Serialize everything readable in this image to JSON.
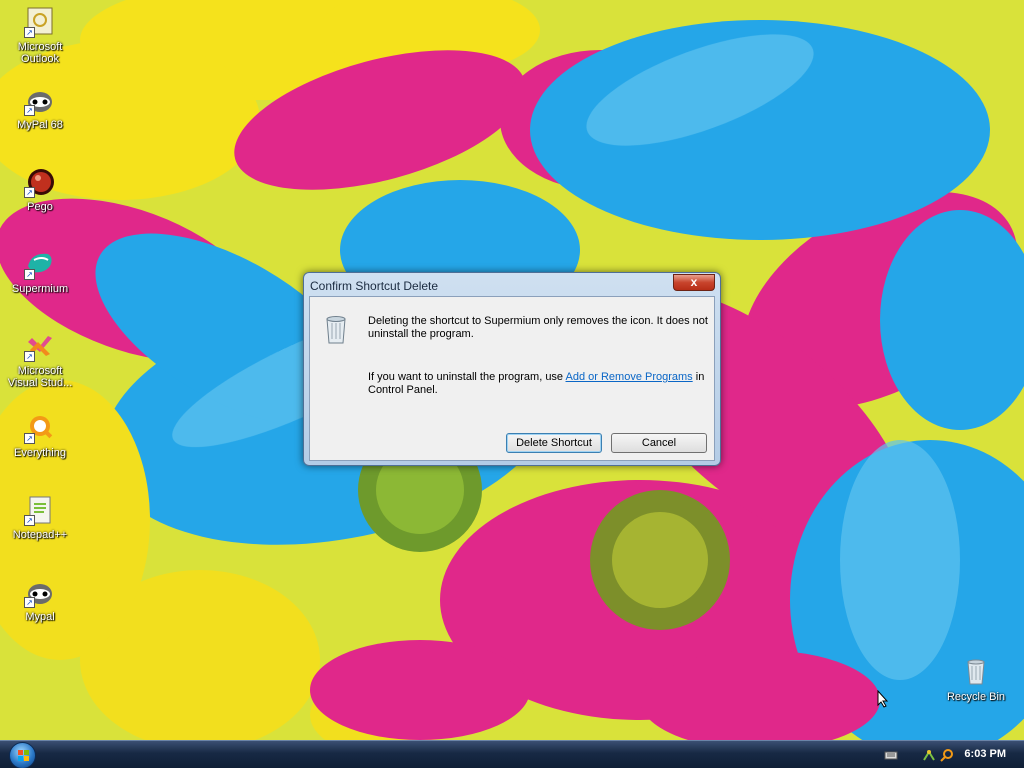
{
  "desktop": {
    "icons": [
      {
        "label": "Microsoft Outlook",
        "icon": "outlook-icon"
      },
      {
        "label": "MyPal 68",
        "icon": "mypal-icon"
      },
      {
        "label": "Pego",
        "icon": "pego-icon"
      },
      {
        "label": "Supermium",
        "icon": "supermium-icon"
      },
      {
        "label": "Microsoft Visual Stud...",
        "icon": "visual-studio-icon"
      },
      {
        "label": "Everything",
        "icon": "everything-icon"
      },
      {
        "label": "Notepad++",
        "icon": "notepad-plus-plus-icon"
      },
      {
        "label": "Mypal",
        "icon": "mypal-icon"
      },
      {
        "label": "Recycle Bin",
        "icon": "recycle-bin-icon"
      }
    ]
  },
  "dialog": {
    "title": "Confirm Shortcut Delete",
    "close_label": "x",
    "message_1": "Deleting the shortcut to Supermium only removes the icon. It does not uninstall the program.",
    "message_2_prefix": "If you want to uninstall the program, use ",
    "message_2_link": "Add or Remove Programs",
    "message_2_suffix": " in Control Panel.",
    "buttons": {
      "delete": "Delete Shortcut",
      "cancel": "Cancel"
    }
  },
  "taskbar": {
    "clock": "6:03 PM",
    "tray_icons": [
      "keyboard-icon",
      "network-icon",
      "search-icon"
    ]
  },
  "colors": {
    "link": "#0a66c6",
    "taskbar": "#172944",
    "close_button": "#c8442c"
  }
}
